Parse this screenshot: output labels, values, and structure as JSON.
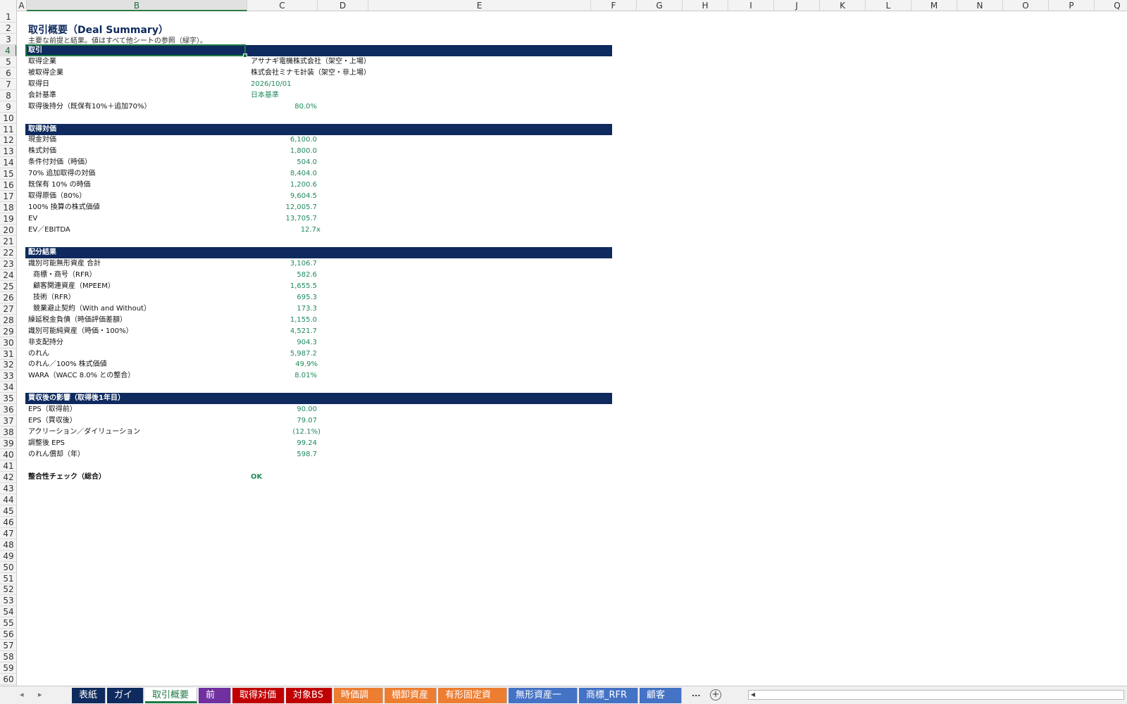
{
  "columns": [
    "A",
    "B",
    "C",
    "D",
    "E",
    "F",
    "G",
    "H",
    "I",
    "J",
    "K",
    "L",
    "M",
    "N",
    "O",
    "P",
    "Q"
  ],
  "selected_column": "B",
  "selected_row": "4",
  "rows": [
    "1",
    "2",
    "3",
    "4",
    "5",
    "6",
    "7",
    "8",
    "9",
    "10",
    "11",
    "12",
    "13",
    "14",
    "15",
    "16",
    "17",
    "18",
    "19",
    "20",
    "21",
    "22",
    "23",
    "24",
    "25",
    "26",
    "27",
    "28",
    "29",
    "30",
    "31",
    "32",
    "33",
    "34",
    "35",
    "36",
    "37",
    "38",
    "39",
    "40",
    "41",
    "42",
    "43",
    "44",
    "45",
    "46",
    "47",
    "48",
    "49",
    "50",
    "51",
    "52",
    "53",
    "54",
    "55",
    "56",
    "57",
    "58",
    "59",
    "60"
  ],
  "sheet": {
    "title": "取引概要（Deal Summary）",
    "subtitle": "主要な前提と結果。値はすべて他シートの参照（緑字）。",
    "sections": {
      "transaction": {
        "header": "取引",
        "items": [
          {
            "label": "取得企業",
            "value": "アサナギ電機株式会社（架空・上場）"
          },
          {
            "label": "被取得企業",
            "value": "株式会社ミナモ計装（架空・非上場）"
          },
          {
            "label": "取得日",
            "value": "2026/10/01"
          },
          {
            "label": "会計基準",
            "value": "日本基準"
          },
          {
            "label": "取得後持分（既保有10%＋追加70%）",
            "value": "80.0%"
          }
        ]
      },
      "consideration": {
        "header": "取得対価",
        "items": [
          {
            "label": "現金対価",
            "value": "6,100.0"
          },
          {
            "label": "株式対価",
            "value": "1,800.0"
          },
          {
            "label": "条件付対価（時価）",
            "value": "504.0"
          },
          {
            "label": "70% 追加取得の対価",
            "value": "8,404.0"
          },
          {
            "label": "既保有 10% の時価",
            "value": "1,200.6"
          },
          {
            "label": "取得原価（80%）",
            "value": "9,604.5"
          },
          {
            "label": "100% 換算の株式価値",
            "value": "12,005.7"
          },
          {
            "label": "EV",
            "value": "13,705.7"
          },
          {
            "label": "EV／EBITDA",
            "value": "12.7x"
          }
        ]
      },
      "allocation": {
        "header": "配分結果",
        "items": [
          {
            "label": "識別可能無形資産 合計",
            "value": "3,106.7"
          },
          {
            "label": "商標・商号（RFR）",
            "value": "582.6"
          },
          {
            "label": "顧客関連資産（MPEEM）",
            "value": "1,655.5"
          },
          {
            "label": "技術（RFR）",
            "value": "695.3"
          },
          {
            "label": "競業避止契約（With and Without）",
            "value": "173.3"
          },
          {
            "label": "繰延税金負債（時価評価差額）",
            "value": "1,155.0"
          },
          {
            "label": "識別可能純資産（時価・100%）",
            "value": "4,521.7"
          },
          {
            "label": "非支配持分",
            "value": "904.3"
          },
          {
            "label": "のれん",
            "value": "5,987.2"
          },
          {
            "label": "のれん／100% 株式価値",
            "value": "49.9%"
          },
          {
            "label": "WARA（WACC 8.0% との整合）",
            "value": "8.01%"
          }
        ]
      },
      "impact": {
        "header": "買収後の影響（取得後1年目）",
        "items": [
          {
            "label": "EPS（取得前）",
            "value": "90.00"
          },
          {
            "label": "EPS（買収後）",
            "value": "79.07"
          },
          {
            "label": "アクリーション／ダイリューション",
            "value": "(12.1%)"
          },
          {
            "label": "調整後 EPS",
            "value": "99.24"
          },
          {
            "label": "のれん償却（年）",
            "value": "598.7"
          }
        ]
      },
      "check": {
        "label": "整合性チェック（総合）",
        "value": "OK"
      }
    }
  },
  "tabs": [
    {
      "label": "表紙",
      "color": "#0e2a5e",
      "active": false
    },
    {
      "label": "ガイド",
      "color": "#0e2a5e",
      "active": false
    },
    {
      "label": "取引概要",
      "color": "#ffffff",
      "active": true
    },
    {
      "label": "前提",
      "color": "#7030a0",
      "active": false
    },
    {
      "label": "取得対価",
      "color": "#c00000",
      "active": false
    },
    {
      "label": "対象BS",
      "color": "#c00000",
      "active": false
    },
    {
      "label": "時価調整",
      "color": "#ed7d31",
      "active": false
    },
    {
      "label": "棚卸資産",
      "color": "#ed7d31",
      "active": false
    },
    {
      "label": "有形固定資産",
      "color": "#ed7d31",
      "active": false
    },
    {
      "label": "無形資産一覧",
      "color": "#4472c4",
      "active": false
    },
    {
      "label": "商標_RFR",
      "color": "#4472c4",
      "active": false
    },
    {
      "label": "顧客_M",
      "color": "#4472c4",
      "active": false
    }
  ],
  "tab_overflow": "...",
  "add_sheet_symbol": "+",
  "colors": {
    "header_navy": "#0e2a5e",
    "reference_green": "#1f8a5b",
    "selection_green": "#1e7a45"
  }
}
